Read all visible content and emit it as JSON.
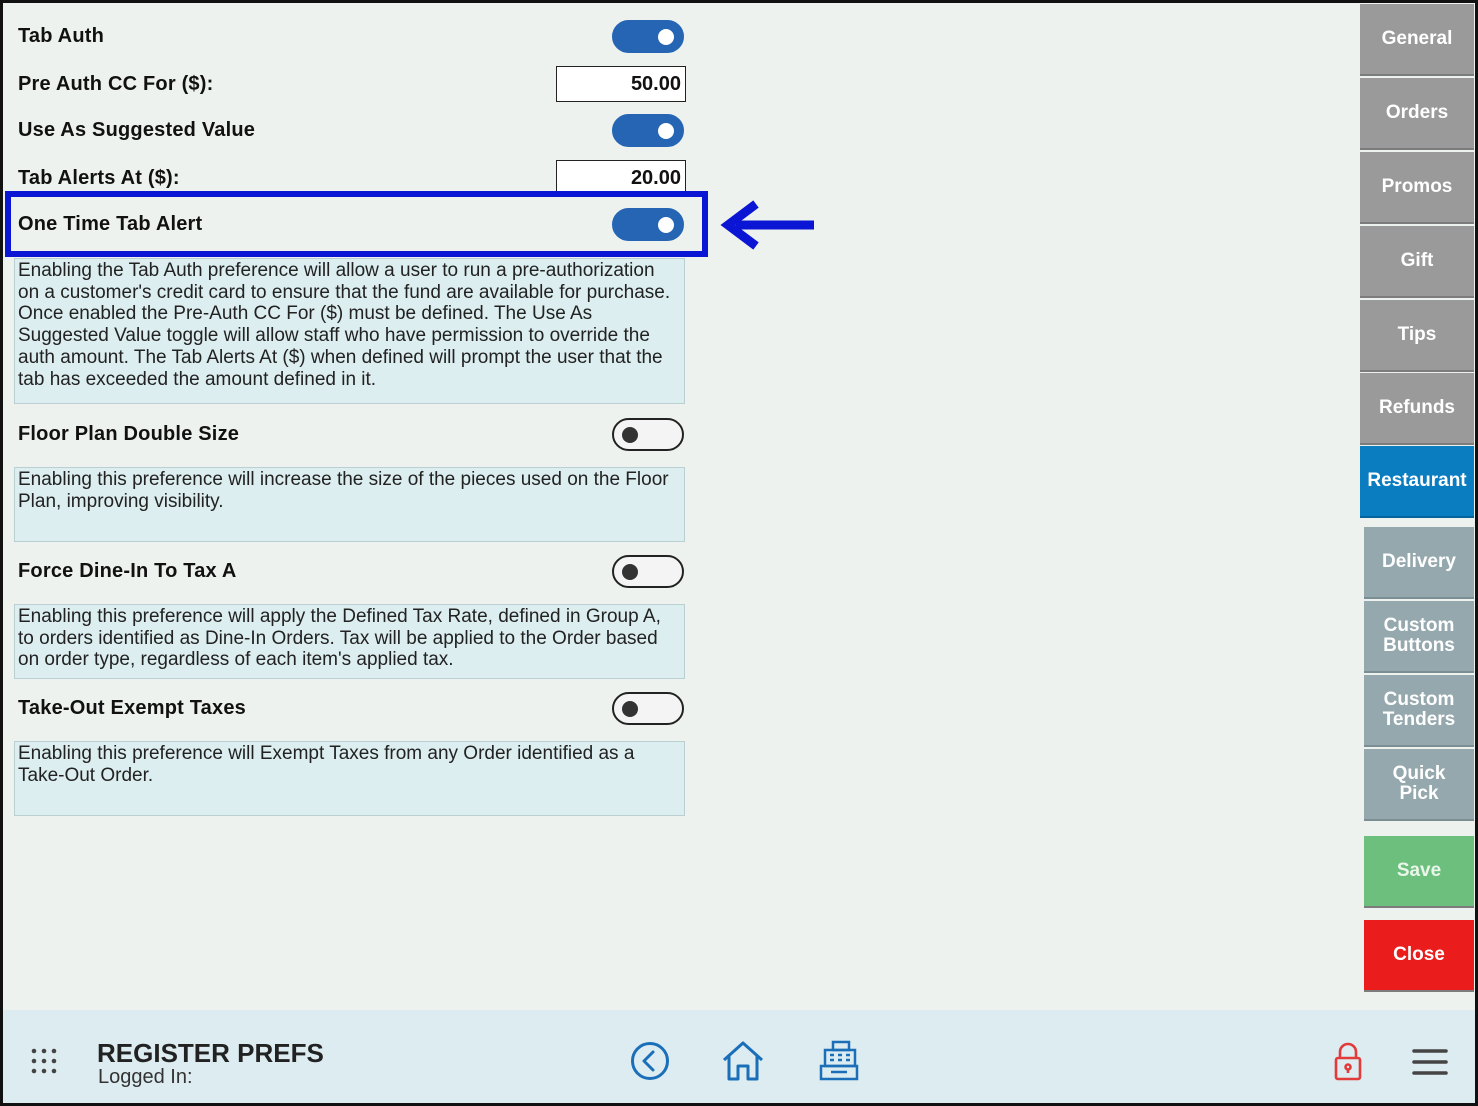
{
  "settings": {
    "tab_auth": {
      "label": "Tab Auth",
      "enabled": true
    },
    "pre_auth": {
      "label": "Pre Auth CC For ($):",
      "value": "50.00"
    },
    "suggested": {
      "label": "Use As Suggested Value",
      "enabled": true
    },
    "tab_alerts": {
      "label": "Tab Alerts At ($):",
      "value": "20.00"
    },
    "one_time": {
      "label": "One Time Tab Alert",
      "enabled": true
    },
    "tab_auth_desc": "Enabling the Tab Auth preference will allow a user to run a pre-authorization on a customer's credit card to ensure that the fund are available for purchase. Once enabled the Pre-Auth CC For ($) must be defined. The Use As Suggested Value toggle will allow staff who have permission to override the auth amount. The Tab Alerts At ($) when defined will prompt the user that the tab has exceeded the amount defined in it.",
    "floor_plan": {
      "label": "Floor Plan Double Size",
      "enabled": false,
      "desc": "Enabling this preference will increase the size of the pieces used on the Floor Plan, improving visibility."
    },
    "force_dine_in": {
      "label": "Force Dine-In To Tax A",
      "enabled": false,
      "desc": "Enabling this preference will apply the Defined Tax Rate, defined in Group A, to orders identified as Dine-In Orders. Tax will be applied to the Order based on order type, regardless of each item's applied tax."
    },
    "take_out": {
      "label": "Take-Out Exempt Taxes",
      "enabled": false,
      "desc": "Enabling this preference will Exempt Taxes from any Order identified as a Take-Out Order."
    }
  },
  "sidebar": {
    "general": "General",
    "orders": "Orders",
    "promos": "Promos",
    "gift": "Gift",
    "tips": "Tips",
    "refunds": "Refunds",
    "restaurant": "Restaurant",
    "delivery": "Delivery",
    "custom_buttons": "Custom Buttons",
    "custom_tenders": "Custom Tenders",
    "quick_pick": "Quick Pick",
    "save": "Save",
    "close": "Close"
  },
  "bottom_bar": {
    "title": "REGISTER PREFS",
    "subtitle": "Logged In:"
  },
  "colors": {
    "toggle_on": "#2565b4",
    "active_tab": "#0a7cc0",
    "save": "#6cbf7c",
    "close": "#ea1c1c",
    "annotation": "#0a16d4"
  },
  "icons": [
    "apps-grid-icon",
    "back-circle-icon",
    "home-icon",
    "cash-register-icon",
    "lock-icon",
    "hamburger-menu-icon",
    "arrow-left-annotation"
  ]
}
